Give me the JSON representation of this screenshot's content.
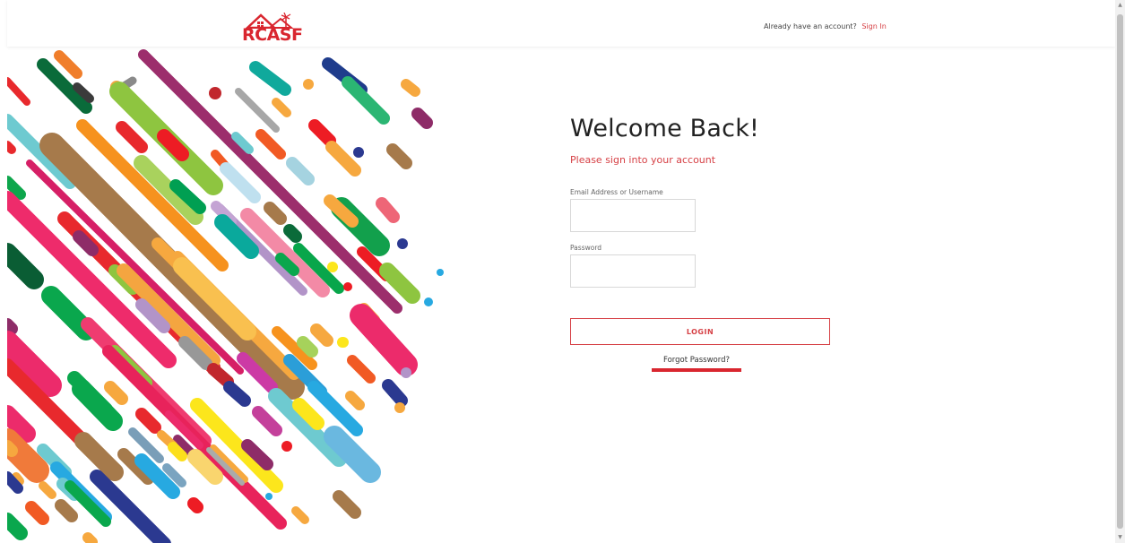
{
  "header": {
    "logo_text": "RCASF",
    "account_prompt": "Already have an account?",
    "sign_in_label": "Sign In"
  },
  "main": {
    "title": "Welcome Back!",
    "subtitle": "Please sign into your account",
    "email_label": "Email Address or Username",
    "email_value": "",
    "password_label": "Password",
    "password_value": "",
    "login_label": "LOGIN",
    "forgot_label": "Forgot Password?"
  },
  "colors": {
    "accent": "#d64045",
    "brand": "#d9262f"
  },
  "scrollbar": {
    "up_icon": "▲",
    "down_icon": "▼"
  }
}
